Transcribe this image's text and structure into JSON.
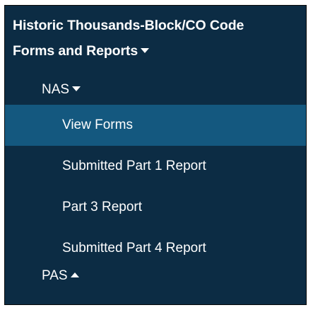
{
  "header": {
    "line1": "Historic Thousands-Block/CO Code",
    "line2": "Forms and Reports",
    "caret_icon": "caret-down-icon"
  },
  "nas": {
    "label": "NAS",
    "caret_icon": "caret-down-icon",
    "items": [
      {
        "label": "View Forms",
        "active": true
      },
      {
        "label": "Submitted Part 1 Report",
        "active": false
      },
      {
        "label": "Part 3 Report",
        "active": false
      },
      {
        "label": "Submitted Part 4 Report",
        "active": false
      }
    ]
  },
  "pas": {
    "label": "PAS",
    "caret_icon": "caret-up-icon"
  },
  "colors": {
    "panel_bg": "#0c2c44",
    "active_bg": "#14587f",
    "text": "#ffffff"
  }
}
